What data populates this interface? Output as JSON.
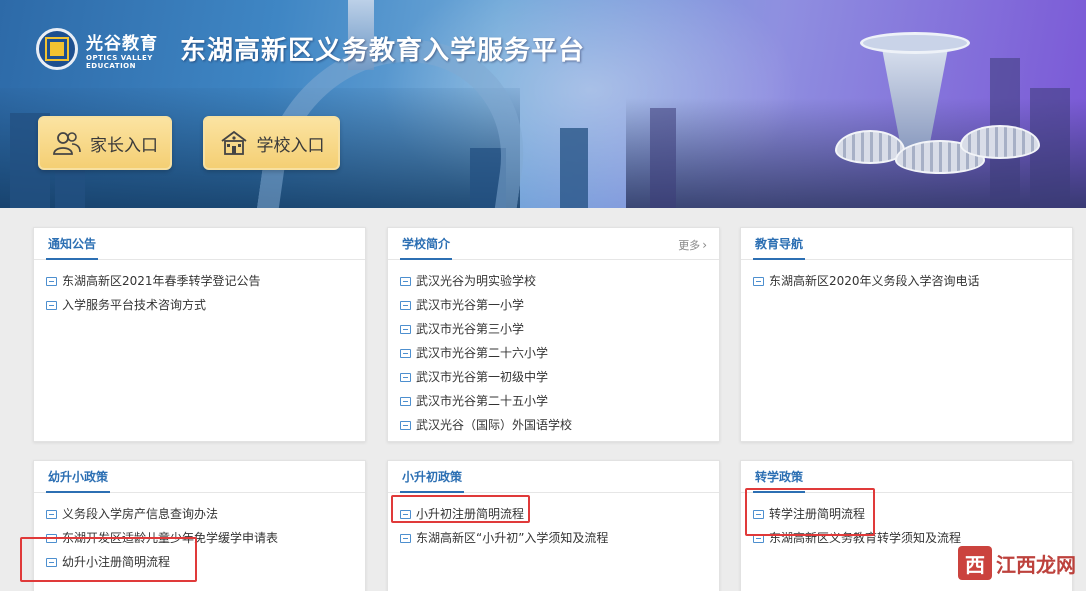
{
  "header": {
    "logo_cn": "光谷教育",
    "logo_en_1": "OPTICS VALLEY",
    "logo_en_2": "EDUCATION",
    "site_title": "东湖高新区义务教育入学服务平台",
    "parent_entry": "家长入口",
    "school_entry": "学校入口"
  },
  "panels": {
    "notice": {
      "title": "通知公告",
      "items": [
        "东湖高新区2021年春季转学登记公告",
        "入学服务平台技术咨询方式"
      ]
    },
    "schools": {
      "title": "学校简介",
      "more": "更多",
      "items": [
        "武汉光谷为明实验学校",
        "武汉市光谷第一小学",
        "武汉市光谷第三小学",
        "武汉市光谷第二十六小学",
        "武汉市光谷第一初级中学",
        "武汉市光谷第二十五小学",
        "武汉光谷（国际）外国语学校"
      ]
    },
    "guide": {
      "title": "教育导航",
      "items": [
        "东湖高新区2020年义务段入学咨询电话"
      ]
    },
    "kindergarten": {
      "title": "幼升小政策",
      "items": [
        "义务段入学房产信息查询办法",
        "东湖开发区适龄儿童少年免学缓学申请表",
        "幼升小注册简明流程"
      ]
    },
    "primary": {
      "title": "小升初政策",
      "items": [
        "小升初注册简明流程",
        "东湖高新区“小升初”入学须知及流程"
      ]
    },
    "transfer": {
      "title": "转学政策",
      "items": [
        "转学注册简明流程",
        "东湖高新区义务教育转学须知及流程"
      ]
    }
  },
  "watermark": {
    "mark": "西",
    "text": "江西龙网"
  },
  "colors": {
    "accent": "#2c6fb3",
    "highlight": "#e03a3a",
    "entry_button": "#f4cf74"
  }
}
